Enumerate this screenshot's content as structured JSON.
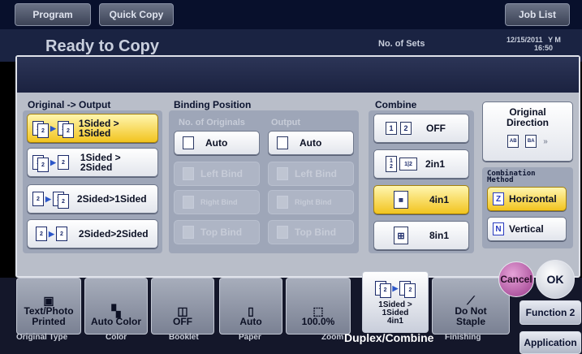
{
  "topbar": {
    "program": "Program",
    "quick_copy": "Quick Copy",
    "job_list": "Job List"
  },
  "status": {
    "title": "Ready to Copy",
    "sets_label": "No. of Sets",
    "date": "12/15/2011",
    "time": "16:50",
    "toner": "Y M"
  },
  "sections": {
    "original_output": "Original -> Output",
    "binding_position": "Binding Position",
    "no_of_originals": "No. of Originals",
    "output": "Output",
    "combine": "Combine",
    "original_direction": "Original Direction",
    "combination_method": "Combination Method"
  },
  "duplex": [
    {
      "label": "1Sided >\n1Sided",
      "selected": true
    },
    {
      "label": "1Sided >\n2Sided",
      "selected": false
    },
    {
      "label": "2Sided>1Sided",
      "selected": false
    },
    {
      "label": "2Sided>2Sided",
      "selected": false
    }
  ],
  "binding_originals": [
    "Auto",
    "Left Bind",
    "Right Bind",
    "Top Bind"
  ],
  "binding_output": [
    "Auto",
    "Left Bind",
    "Right Bind",
    "Top Bind"
  ],
  "combine": [
    {
      "label": "OFF",
      "selected": false
    },
    {
      "label": "2in1",
      "selected": false
    },
    {
      "label": "4in1",
      "selected": true
    },
    {
      "label": "8in1",
      "selected": false
    }
  ],
  "combination_method": [
    {
      "label": "Horizontal",
      "selected": true
    },
    {
      "label": "Vertical",
      "selected": false
    }
  ],
  "actions": {
    "cancel": "Cancel",
    "ok": "OK"
  },
  "tiles": [
    {
      "label": "Text/Photo\nPrinted",
      "caption": "Original Type"
    },
    {
      "label": "Auto Color",
      "caption": "Color"
    },
    {
      "label": "OFF",
      "caption": "Booklet"
    },
    {
      "label": "Auto",
      "caption": "Paper"
    },
    {
      "label": "100.0%",
      "caption": "Zoom"
    },
    {
      "label": "1Sided >\n1Sided\n4in1",
      "caption": "Duplex/Combine"
    },
    {
      "label": "Do Not\nStaple",
      "caption": "Finishing"
    }
  ],
  "side": {
    "function2": "Function 2",
    "application": "Application"
  },
  "colors": {
    "selected": "#f2c41f",
    "dialog_bg": "#b9bec9",
    "topbar": "#08102c"
  }
}
